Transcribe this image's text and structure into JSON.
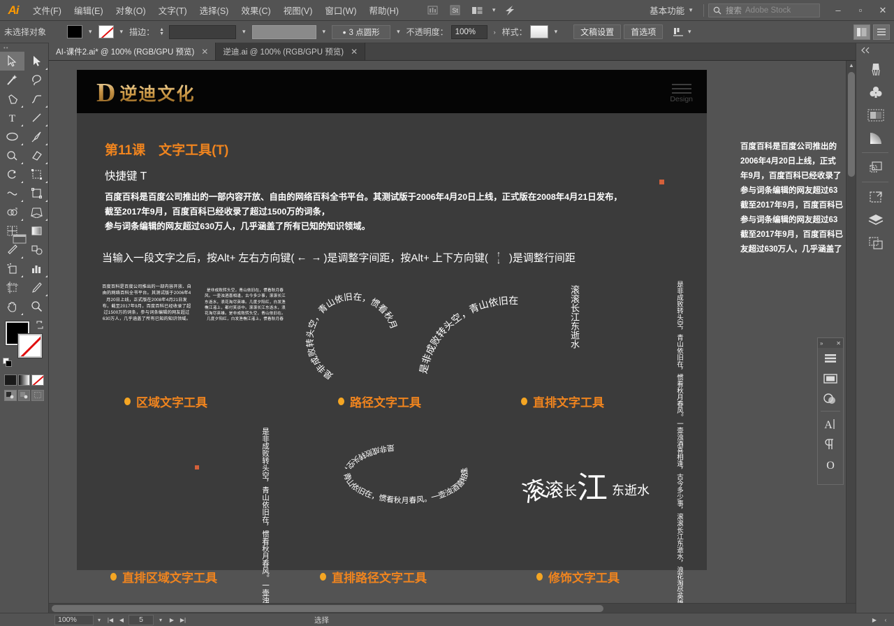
{
  "app": {
    "name": "Adobe Illustrator",
    "logo_text": "Ai"
  },
  "menubar": {
    "items": [
      {
        "label": "文件(F)",
        "name": "menu-file"
      },
      {
        "label": "编辑(E)",
        "name": "menu-edit"
      },
      {
        "label": "对象(O)",
        "name": "menu-object"
      },
      {
        "label": "文字(T)",
        "name": "menu-type"
      },
      {
        "label": "选择(S)",
        "name": "menu-select"
      },
      {
        "label": "效果(C)",
        "name": "menu-effect"
      },
      {
        "label": "视图(V)",
        "name": "menu-view"
      },
      {
        "label": "窗口(W)",
        "name": "menu-window"
      },
      {
        "label": "帮助(H)",
        "name": "menu-help"
      }
    ],
    "bridge_icon": "br-icon",
    "stock_icon": "st-icon",
    "arrange_icon": "arrange-documents-icon",
    "workspace": "基本功能",
    "search_placeholder": "搜索",
    "search_brand": "Adobe Stock",
    "win_minimize": "–",
    "win_maximize": "▫",
    "win_close": "✕"
  },
  "controlbar": {
    "selection_status": "未选择对象",
    "fill_color": "#000000",
    "stroke_color": "none",
    "stroke_label": "描边：",
    "stroke_weight": "",
    "stroke_profile": "",
    "brush_definition": "3 点圆形",
    "opacity_label": "不透明度：",
    "opacity_value": "100%",
    "style_label": "样式：",
    "doc_setup": "文稿设置",
    "preferences": "首选项",
    "align_label": "对齐",
    "panel_icon_1": "arrange-panel-icon",
    "panel_icon_2": "panel-menu-icon"
  },
  "tabs": [
    {
      "label": "AI-课件2.ai* @ 100% (RGB/GPU 预览)",
      "active": true,
      "close": "✕"
    },
    {
      "label": "逆迪.ai @ 100% (RGB/GPU 预览)",
      "active": false,
      "close": "✕"
    }
  ],
  "toolbar": {
    "tools": [
      {
        "name": "selection-tool",
        "selected": true
      },
      {
        "name": "direct-selection-tool",
        "selected": false
      },
      {
        "name": "magic-wand-tool",
        "selected": false
      },
      {
        "name": "lasso-tool",
        "selected": false
      },
      {
        "name": "pen-tool",
        "selected": false
      },
      {
        "name": "curvature-tool",
        "selected": false
      },
      {
        "name": "type-tool",
        "selected": false
      },
      {
        "name": "line-segment-tool",
        "selected": false
      },
      {
        "name": "ellipse-tool",
        "selected": false
      },
      {
        "name": "paintbrush-tool",
        "selected": false
      },
      {
        "name": "shaper-tool",
        "selected": false
      },
      {
        "name": "eraser-tool",
        "selected": false
      },
      {
        "name": "rotate-tool",
        "selected": false
      },
      {
        "name": "scale-tool",
        "selected": false
      },
      {
        "name": "width-tool",
        "selected": false
      },
      {
        "name": "free-transform-tool",
        "selected": false
      },
      {
        "name": "shape-builder-tool",
        "selected": false
      },
      {
        "name": "perspective-grid-tool",
        "selected": false
      },
      {
        "name": "mesh-tool",
        "selected": false
      },
      {
        "name": "gradient-tool",
        "selected": false
      },
      {
        "name": "eyedropper-tool",
        "selected": false
      },
      {
        "name": "blend-tool",
        "selected": false
      },
      {
        "name": "symbol-sprayer-tool",
        "selected": false
      },
      {
        "name": "column-graph-tool",
        "selected": false
      },
      {
        "name": "artboard-tool",
        "selected": false
      },
      {
        "name": "slice-tool",
        "selected": false
      },
      {
        "name": "hand-tool",
        "selected": false
      },
      {
        "name": "zoom-tool",
        "selected": false
      }
    ],
    "fill_color": "#000000",
    "stroke_color": "none",
    "color_modes": [
      "color",
      "gradient",
      "none"
    ],
    "draw_modes": [
      "draw-normal",
      "draw-behind",
      "draw-inside"
    ]
  },
  "artboard": {
    "brand": {
      "mark": "D",
      "name": "逆迪文化"
    },
    "design_menu_label": "Design",
    "lesson_title": "第11课　文字工具(T)",
    "shortcut": "快捷键 T",
    "paragraph": [
      "百度百科是百度公司推出的一部内容开放、自由的网络百科全书平台。其测试版于2006年4月20日上线，正式版在2008年4月21日发布，",
      "截至2017年9月，百度百科已经收录了超过1500万的词条，",
      "参与词条编辑的网友超过630万人，几乎涵盖了所有已知的知识领域。"
    ],
    "hint": {
      "part1": "当输入一段文字之后，按Alt+ 左右方向键(",
      "arrow_left": "←",
      "arrow_right": "→",
      "part2": ")是调整字间距，按Alt+ 上下方向键(",
      "arrow_up": "↑",
      "arrow_down": "↓",
      "part3": ")是调整行间距"
    },
    "area_type_sample": "百度百科是百度公司推出的一部内容开放、自由的网络百科全书平台。其测试版于2006年4月20日上线，正式版在2008年4月21日发布，截至2017年9月，百度百科已经收录了超过1500万的词条，参与词条编辑的网友超过630万人，几乎涵盖了所有已知的知识领域。",
    "area_type_sample2": "是非成败转头空，青山依旧在，惯看秋月春风。一壶浊酒喜相逢，古今多少事，滚滚长江东逝水，浪花淘尽英雄。几度夕阳红，白发渔樵江渚上，都付笑谈中。滚滚长江东逝水，浪花淘尽英雄。是非成败转头空，青山依旧在。几度夕阳红，白发渔樵江渚上，惯看秋月春",
    "path_type_sample": "是非成败转头空，青山依旧在，惯看秋月",
    "path_type_sample2": "是非成败转头空，青山依旧在",
    "vertical_sample_1": "滚滚长江东逝水",
    "vertical_sample_2": "是非成败转头空，青山依旧在，惯看秋月春风。一壶浊酒喜相逢，古今多少事，滚滚长江东逝水，浪花淘尽英雄。几度夕阳红，白发渔樵江渚上",
    "vertical_area_sample": "是非成败转头空，青山依旧在，惯看秋月春风。一壶浊酒喜相逢，古今多少事，滚滚长江东逝水，浪花淘尽英雄。几度夕阳红，白发渔樵江渚上",
    "vertical_path_sample": "是非成败转头空，青山依旧在，惯看秋月春风。一壶浊酒喜相逢",
    "touch_type_sample": "滚滚长江东逝水",
    "labels_row1": [
      {
        "text": "区域文字工具",
        "name": "label-area-type-tool"
      },
      {
        "text": "路径文字工具",
        "name": "label-type-on-path-tool"
      },
      {
        "text": "直排文字工具",
        "name": "label-vertical-type-tool"
      }
    ],
    "labels_row2": [
      {
        "text": "直排区域文字工具",
        "name": "label-vertical-area-type-tool"
      },
      {
        "text": "直排路径文字工具",
        "name": "label-vertical-type-on-path-tool"
      },
      {
        "text": "修饰文字工具",
        "name": "label-touch-type-tool"
      }
    ],
    "accent_color": "#f0841e",
    "dot_color": "#f5a623"
  },
  "scratch_text": [
    "百度百科是百度公司推出的",
    "2006年4月20日上线，正式",
    "年9月，百度百科已经收录了",
    "参与词条编辑的网友超过63",
    "截至2017年9月，百度百科已",
    "参与词条编辑的网友超过63",
    "截至2017年9月，百度百科已",
    "友超过630万人，几乎涵盖了"
  ],
  "right_dock": {
    "buttons": [
      {
        "name": "brushes-panel-icon"
      },
      {
        "name": "symbols-panel-icon"
      },
      {
        "name": "transparency-panel-icon"
      },
      {
        "name": "gradient-panel-icon"
      },
      {
        "name": "transform-panel-icon"
      },
      {
        "name": "artboards-panel-icon"
      },
      {
        "name": "layers-panel-icon"
      },
      {
        "name": "links-panel-icon"
      }
    ],
    "collapse_icon": "expand-panels-icon"
  },
  "float_panel": {
    "collapse_icon": "collapse-panel-icon",
    "close_icon": "close-panel-icon",
    "buttons": [
      {
        "name": "align-panel-icon"
      },
      {
        "name": "pathfinder-panel-icon"
      },
      {
        "name": "appearance-panel-icon"
      },
      {
        "name": "character-panel-icon"
      },
      {
        "name": "paragraph-panel-icon"
      },
      {
        "name": "opentype-panel-icon"
      }
    ]
  },
  "statusbar": {
    "zoom": "100%",
    "artboard_number": "5",
    "status_text": "选择",
    "first_icon": "first-artboard-icon",
    "prev_icon": "prev-artboard-icon",
    "next_icon": "next-artboard-icon",
    "last_icon": "last-artboard-icon"
  }
}
